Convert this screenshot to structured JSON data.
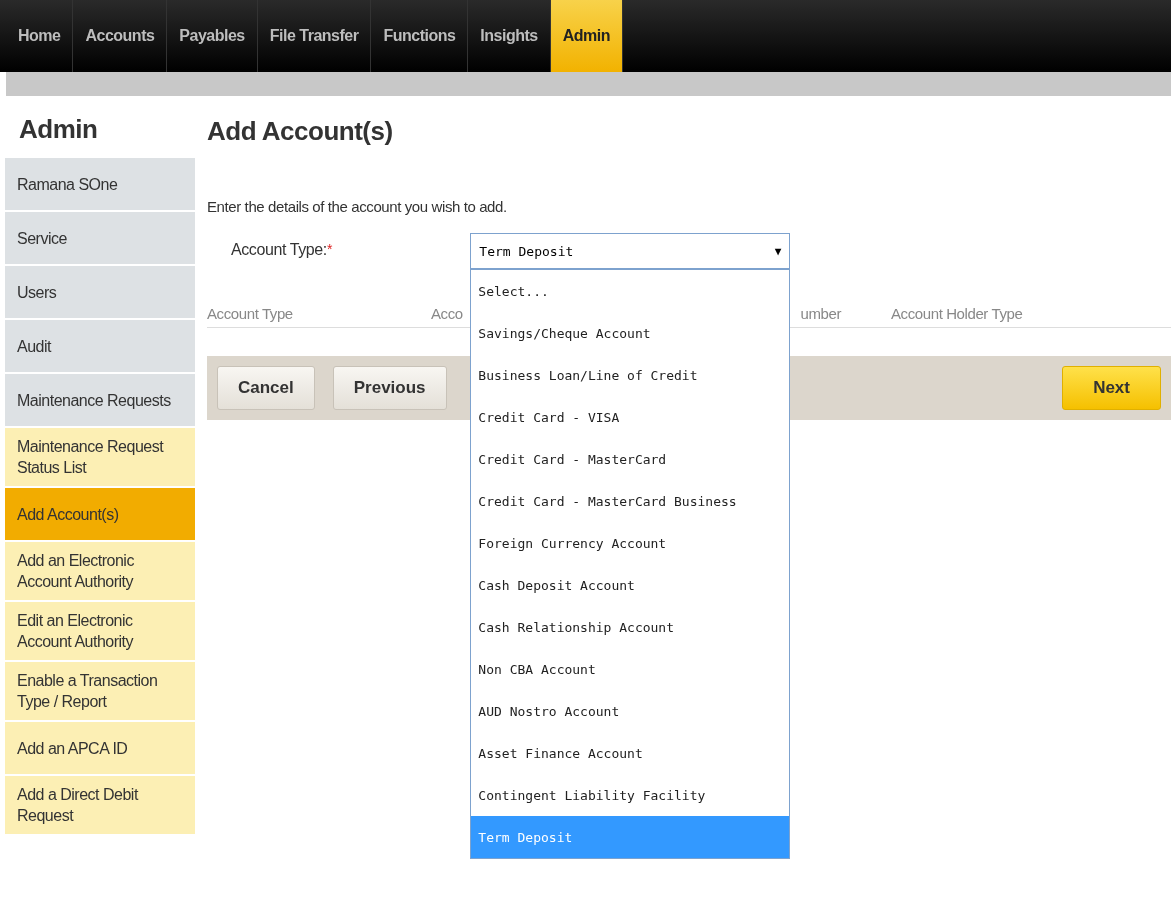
{
  "nav": {
    "tabs": [
      {
        "label": "Home",
        "selected": false
      },
      {
        "label": "Accounts",
        "selected": false
      },
      {
        "label": "Payables",
        "selected": false
      },
      {
        "label": "File Transfer",
        "selected": false
      },
      {
        "label": "Functions",
        "selected": false
      },
      {
        "label": "Insights",
        "selected": false
      },
      {
        "label": "Admin",
        "selected": true
      }
    ]
  },
  "sidebar": {
    "title": "Admin",
    "items": [
      {
        "label": "Ramana SOne",
        "kind": "section",
        "selected": false
      },
      {
        "label": "Service",
        "kind": "section",
        "selected": false
      },
      {
        "label": "Users",
        "kind": "section",
        "selected": false
      },
      {
        "label": "Audit",
        "kind": "section",
        "selected": false
      },
      {
        "label": "Maintenance Requests",
        "kind": "section",
        "selected": false
      },
      {
        "label": "Maintenance Request Status List",
        "kind": "task",
        "selected": false
      },
      {
        "label": "Add Account(s)",
        "kind": "task",
        "selected": true
      },
      {
        "label": "Add an Electronic Account Authority",
        "kind": "task",
        "selected": false
      },
      {
        "label": "Edit an Electronic Account Authority",
        "kind": "task",
        "selected": false
      },
      {
        "label": "Enable a Transaction Type / Report",
        "kind": "task",
        "selected": false
      },
      {
        "label": "Add an APCA ID",
        "kind": "task",
        "selected": false
      },
      {
        "label": "Add a Direct Debit Request",
        "kind": "task",
        "selected": false
      }
    ]
  },
  "page": {
    "title": "Add Account(s)",
    "intro": "Enter the details of the account you wish to add.",
    "account_type": {
      "label": "Account Type:",
      "required_mark": "*",
      "value": "Term Deposit",
      "arrow": "▼",
      "expanded": true,
      "options": [
        {
          "label": "Select...",
          "selected": false
        },
        {
          "label": "Savings/Cheque Account",
          "selected": false
        },
        {
          "label": "Business Loan/Line of Credit",
          "selected": false
        },
        {
          "label": "Credit Card - VISA",
          "selected": false
        },
        {
          "label": "Credit Card - MasterCard",
          "selected": false
        },
        {
          "label": "Credit Card - MasterCard Business",
          "selected": false
        },
        {
          "label": "Foreign Currency Account",
          "selected": false
        },
        {
          "label": "Cash Deposit Account",
          "selected": false
        },
        {
          "label": "Cash Relationship Account",
          "selected": false
        },
        {
          "label": "Non CBA Account",
          "selected": false
        },
        {
          "label": "AUD Nostro Account",
          "selected": false
        },
        {
          "label": "Asset Finance Account",
          "selected": false
        },
        {
          "label": "Contingent Liability Facility",
          "selected": false
        },
        {
          "label": "Term Deposit",
          "selected": true
        }
      ]
    },
    "table": {
      "columns": [
        "Account Type",
        "Acco",
        "umber",
        "Account Holder Type"
      ]
    },
    "buttons": [
      {
        "label": "Cancel",
        "kind": "secondary"
      },
      {
        "label": "Previous",
        "kind": "secondary"
      },
      {
        "label": "Next",
        "kind": "primary"
      }
    ]
  }
}
